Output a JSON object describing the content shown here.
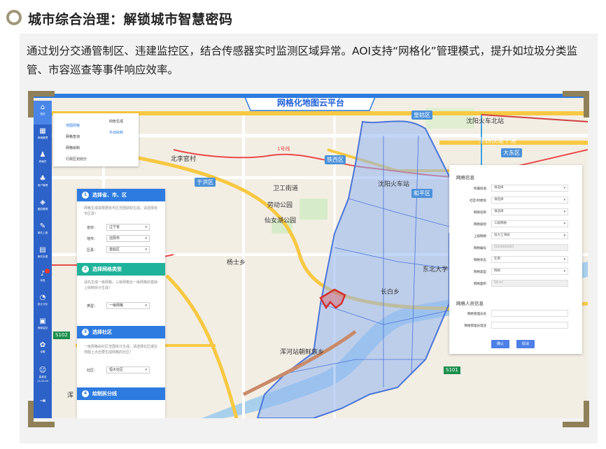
{
  "header": {
    "title": "城市综合治理：解锁城市智慧密码"
  },
  "intro": {
    "text": "通过划分交通管制区、违建监控区，结合传感器实时监测区域异常。AOI支持“网格化”管理模式，提升如垃圾分类监管、市容巡查等事件响应效率。"
  },
  "app": {
    "title": "网格化地图云平台",
    "sidebar": [
      {
        "icon": "home-icon",
        "glyph": "⌂",
        "label": "首页"
      },
      {
        "icon": "grid-manage-icon",
        "glyph": "▦",
        "label": "网格管理"
      },
      {
        "icon": "person-icon",
        "glyph": "♟",
        "label": "网格员"
      },
      {
        "icon": "people-icon",
        "glyph": "♣",
        "label": "用户管理"
      },
      {
        "icon": "layers-icon",
        "glyph": "◈",
        "label": "图层管理"
      },
      {
        "icon": "report-icon",
        "glyph": "✎",
        "label": "事件上报"
      },
      {
        "icon": "clipboard-icon",
        "glyph": "▤",
        "label": "事件处理"
      },
      {
        "icon": "bell-icon",
        "glyph": "♪",
        "label": "消息"
      },
      {
        "icon": "chart-icon",
        "glyph": "◔",
        "label": "统计分析"
      },
      {
        "icon": "video-icon",
        "glyph": "▣",
        "label": "视频监控"
      },
      {
        "icon": "gear-icon",
        "glyph": "✿",
        "label": "设置"
      }
    ],
    "user": {
      "name": "高某某",
      "time": "13:42:49"
    },
    "flyout": {
      "col1": [
        "地图网格",
        "网格查询",
        "网格绘制",
        "行政区划划分"
      ],
      "col2": [
        "四色生成",
        "手动绘制"
      ]
    },
    "left_panel": {
      "sec1": {
        "num": "1",
        "title": "选择省、市、区",
        "desc": "网格生成需根据省市区范围获取生成，请选择省市区县！",
        "fields": [
          {
            "label": "省份：",
            "value": "辽宁省"
          },
          {
            "label": "地市：",
            "value": "沈阳市"
          },
          {
            "label": "区县：",
            "value": "皇姑区"
          }
        ]
      },
      "sec2": {
        "num": "2",
        "title": "选择网格类型",
        "desc": "请先生成一级网格。三级网格在一级网格的基础上绘制拆分生成！",
        "fields": [
          {
            "label": "类型：",
            "value": "一级网格"
          }
        ]
      },
      "sec3": {
        "num": "3",
        "title": "选择社区",
        "desc": "一级网格由社区范围拆分生成。请选择社区或在地图上点击要生成网格的社区！",
        "fields": [
          {
            "label": "社区：",
            "value": "恒大社区"
          }
        ]
      },
      "sec4": {
        "num": "4",
        "title": "绘制拆分线"
      }
    },
    "right_panel": {
      "title": "网格信息",
      "rows": [
        {
          "label": "所属街道",
          "value": "请选择"
        },
        {
          "label": "社区/村委会",
          "value": "请选择"
        },
        {
          "label": "网格名称",
          "value": "请选择"
        },
        {
          "label": "网格级别",
          "value": "三级网格"
        },
        {
          "label": "上级网格",
          "value": "恒大江海城"
        },
        {
          "label": "网格编号",
          "value": "2024601601"
        },
        {
          "label": "网格状态",
          "value": "在用"
        },
        {
          "label": "网格类型",
          "value": "网格"
        },
        {
          "label": "网格面积",
          "value": "50 m²"
        }
      ],
      "staff_title": "网格人员信息",
      "staff_rows": [
        {
          "label": "网格管理员名",
          "value": ""
        },
        {
          "label": "网格管理员电话",
          "value": ""
        }
      ],
      "buttons": {
        "confirm": "确认",
        "cancel": "取消"
      }
    },
    "map_labels": [
      {
        "text": "北李官村"
      },
      {
        "text": "于洪区"
      },
      {
        "text": "卫工街道"
      },
      {
        "text": "劳动公园"
      },
      {
        "text": "仙女湖公园"
      },
      {
        "text": "铁西区"
      },
      {
        "text": "沈阳火车站"
      },
      {
        "text": "和平区"
      },
      {
        "text": "皇姑区"
      },
      {
        "text": "沈阳火车北站"
      },
      {
        "text": "东西快速干道"
      },
      {
        "text": "大东区"
      },
      {
        "text": "杨士乡"
      },
      {
        "text": "长白乡"
      },
      {
        "text": "东北大学"
      },
      {
        "text": "浑河站朝鲜族乡"
      },
      {
        "text": "1号线"
      },
      {
        "text": "S102"
      },
      {
        "text": "S101"
      },
      {
        "text": "浑"
      }
    ]
  }
}
